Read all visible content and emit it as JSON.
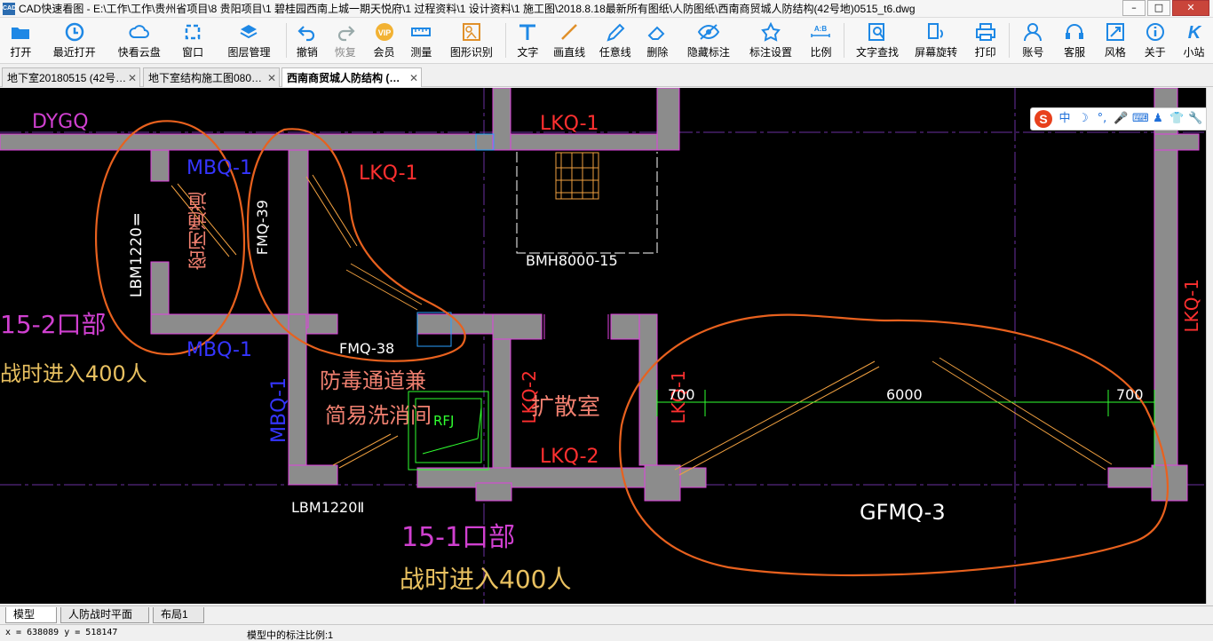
{
  "window": {
    "title": "CAD快速看图 - E:\\工作\\工作\\贵州省项目\\8 贵阳项目\\1  碧桂园西南上城一期天悦府\\1 过程资料\\1 设计资料\\1 施工图\\2018.8.18最新所有图纸\\人防图纸\\西南商贸城人防结构(42号地)0515_t6.dwg",
    "logo_text": "CAD",
    "minimize": "–",
    "maximize": "□",
    "close": "✕"
  },
  "toolbar": [
    {
      "id": "open",
      "label": "打开",
      "icon": "folder-icon"
    },
    {
      "id": "recent",
      "label": "最近打开",
      "icon": "clock-icon"
    },
    {
      "id": "cloud",
      "label": "快看云盘",
      "icon": "cloud-icon"
    },
    {
      "id": "window",
      "label": "窗口",
      "icon": "window-icon"
    },
    {
      "id": "layers",
      "label": "图层管理",
      "icon": "layers-icon"
    },
    {
      "id": "undo",
      "label": "撤销",
      "icon": "undo-icon"
    },
    {
      "id": "redo",
      "label": "恢复",
      "icon": "redo-icon"
    },
    {
      "id": "vip",
      "label": "会员",
      "icon": "vip-icon"
    },
    {
      "id": "measure",
      "label": "测量",
      "icon": "ruler-icon"
    },
    {
      "id": "shape",
      "label": "图形识别",
      "icon": "shape-recognize-icon"
    },
    {
      "id": "text",
      "label": "文字",
      "icon": "text-icon"
    },
    {
      "id": "line",
      "label": "画直线",
      "icon": "line-icon"
    },
    {
      "id": "freeline",
      "label": "任意线",
      "icon": "pen-icon"
    },
    {
      "id": "delete",
      "label": "删除",
      "icon": "eraser-icon"
    },
    {
      "id": "hide",
      "label": "隐藏标注",
      "icon": "eye-icon"
    },
    {
      "id": "markset",
      "label": "标注设置",
      "icon": "settings-icon"
    },
    {
      "id": "scale",
      "label": "比例",
      "icon": "scale-icon"
    },
    {
      "id": "find",
      "label": "文字查找",
      "icon": "search-text-icon"
    },
    {
      "id": "rotate",
      "label": "屏幕旋转",
      "icon": "rotate-screen-icon"
    },
    {
      "id": "print",
      "label": "打印",
      "icon": "printer-icon"
    },
    {
      "id": "account",
      "label": "账号",
      "icon": "user-icon"
    },
    {
      "id": "service",
      "label": "客服",
      "icon": "headset-icon"
    },
    {
      "id": "style",
      "label": "风格",
      "icon": "style-icon"
    },
    {
      "id": "about",
      "label": "关于",
      "icon": "info-icon"
    },
    {
      "id": "site",
      "label": "小站",
      "icon": "k-logo-icon"
    }
  ],
  "tabs": [
    {
      "label": "地下室20180515 (42号…",
      "close": "✕",
      "active": false
    },
    {
      "label": "地下室结构施工图080…",
      "close": "✕",
      "active": false
    },
    {
      "label": "西南商贸城人防结构 (…",
      "close": "✕",
      "active": true
    }
  ],
  "ime": {
    "logo": "S",
    "items": [
      "中",
      "☽",
      "°,",
      "🎤",
      "⌨",
      "♟",
      "👕",
      "🔧"
    ]
  },
  "drawing": {
    "labels": [
      {
        "text": "DYGQ",
        "color": "#d040d0"
      },
      {
        "text": "MBQ-1",
        "color": "#3535ff"
      },
      {
        "text": "LKQ-1",
        "color": "#ff3030"
      },
      {
        "text": "LKQ-1",
        "color": "#ff3030"
      },
      {
        "text": "BMH8000-15",
        "color": "#ffffff"
      },
      {
        "text": "FMQ-39",
        "color": "#ffffff"
      },
      {
        "text": "LBM1220Ⅱ",
        "color": "#ffffff"
      },
      {
        "text": "密闭通道",
        "color": "#f08070"
      },
      {
        "text": "15-2口部",
        "color": "#d040d0"
      },
      {
        "text": "战时进入400人",
        "color": "#e8c060"
      },
      {
        "text": "MBQ-1",
        "color": "#3535ff"
      },
      {
        "text": "FMQ-38",
        "color": "#ffffff"
      },
      {
        "text": "防毒通道兼",
        "color": "#f08070"
      },
      {
        "text": "简易洗消间",
        "color": "#f08070"
      },
      {
        "text": "MBQ-1",
        "color": "#3535ff"
      },
      {
        "text": "RFJ",
        "color": "#30ff30"
      },
      {
        "text": "LKQ-2",
        "color": "#ff3030"
      },
      {
        "text": "扩散室",
        "color": "#f08070"
      },
      {
        "text": "LKQ-1",
        "color": "#ff3030"
      },
      {
        "text": "LKQ-2",
        "color": "#ff3030"
      },
      {
        "text": "700",
        "color": "#ffffff"
      },
      {
        "text": "6000",
        "color": "#ffffff"
      },
      {
        "text": "700",
        "color": "#ffffff"
      },
      {
        "text": "LKQ-1",
        "color": "#ff3030"
      },
      {
        "text": "LBM1220Ⅱ",
        "color": "#ffffff"
      },
      {
        "text": "15-1口部",
        "color": "#d040d0"
      },
      {
        "text": "战时进入400人",
        "color": "#e8c060"
      },
      {
        "text": "GFMQ-3",
        "color": "#ffffff"
      }
    ]
  },
  "layout_tabs": [
    {
      "label": "模型",
      "active": true
    },
    {
      "label": "人防战时平面图",
      "active": false
    },
    {
      "label": "布局1",
      "active": false
    }
  ],
  "status": {
    "coords": "x = 638089  y = 518147",
    "scale": "模型中的标注比例:1"
  },
  "colors": {
    "wall_fill": "#8c8c8c",
    "wall_edge": "#e040e0",
    "annotation": "#e8611e",
    "canvas": "#000000"
  }
}
